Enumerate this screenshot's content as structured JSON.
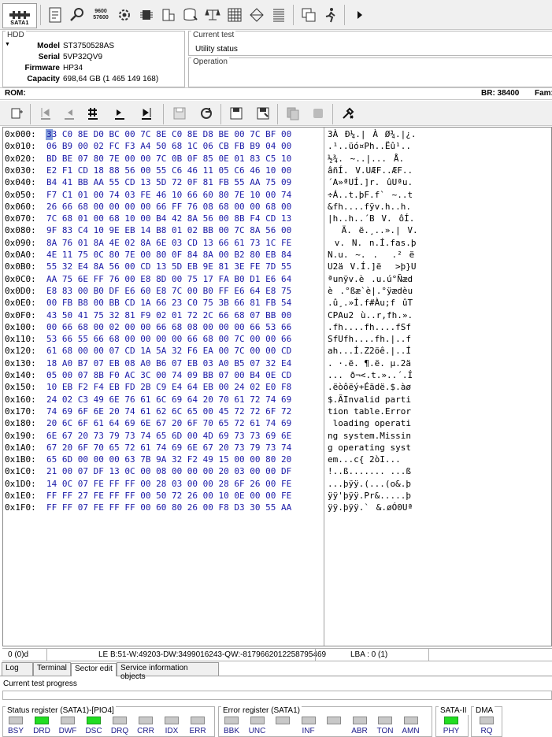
{
  "toolbar": {
    "sata_label": "SATA1",
    "icons": [
      "report-icon",
      "search-icon",
      "baud-rate-icon",
      "settings-icon",
      "chip-icon",
      "drive-icon",
      "database-icon",
      "balance-icon",
      "grid-icon",
      "tree-icon",
      "list-icon",
      "windows-icon",
      "run-icon",
      "play-icon"
    ],
    "baud_icon_text": [
      "9600",
      "57600"
    ]
  },
  "hdd": {
    "title": "HDD",
    "model_label": "Model",
    "model": "ST3750528AS",
    "serial_label": "Serial",
    "serial": "5VP32QV9",
    "firmware_label": "Firmware",
    "firmware": "HP34",
    "capacity_label": "Capacity",
    "capacity": "698,64 GB (1 465 149 168)"
  },
  "current_test": {
    "title": "Current test",
    "value": "Utility status"
  },
  "operation": {
    "title": "Operation",
    "value": ""
  },
  "rom_bar": {
    "rom_label": "ROM:",
    "br": "BR: 38400",
    "fam": "Fam:"
  },
  "hex": {
    "rows": [
      {
        "offset": "0x000:",
        "bytes": "33 C0 8E D0 BC 00 7C 8E C0 8E D8 BE 00 7C BF 00",
        "ascii": "3ÀÐ¼.|ÀØ¾.|¿."
      },
      {
        "offset": "0x010:",
        "bytes": "06 B9 00 02 FC F3 A4 50 68 1C 06 CB FB B9 04 00",
        "ascii": ".¹..üó¤Ph..Ëû¹.."
      },
      {
        "offset": "0x020:",
        "bytes": "BD BE 07 80 7E 00 00 7C 0B 0F 85 0E 01 83 C5 10",
        "ascii": "½¾.~..|...Å."
      },
      {
        "offset": "0x030:",
        "bytes": "E2 F1 CD 18 88 56 00 55 C6 46 11 05 C6 46 10 00",
        "ascii": "âñÍ.V.UÆF..ÆF.."
      },
      {
        "offset": "0x040:",
        "bytes": "B4 41 BB AA 55 CD 13 5D 72 0F 81 FB 55 AA 75 09",
        "ascii": "´A»ªUÍ.]r.ûUªu."
      },
      {
        "offset": "0x050:",
        "bytes": "F7 C1 01 00 74 03 FE 46 10 66 60 80 7E 10 00 74",
        "ascii": "÷Á..t.þF.f`~..t"
      },
      {
        "offset": "0x060:",
        "bytes": "26 66 68 00 00 00 00 66 FF 76 08 68 00 00 68 00",
        "ascii": "&fh....fÿv.h..h."
      },
      {
        "offset": "0x070:",
        "bytes": "7C 68 01 00 68 10 00 B4 42 8A 56 00 8B F4 CD 13",
        "ascii": "|h..h..´BV.ôÍ."
      },
      {
        "offset": "0x080:",
        "bytes": "9F 83 C4 10 9E EB 14 B8 01 02 BB 00 7C 8A 56 00",
        "ascii": "Ä.ë.¸..».|V."
      },
      {
        "offset": "0x090:",
        "bytes": "8A 76 01 8A 4E 02 8A 6E 03 CD 13 66 61 73 1C FE",
        "ascii": "v.N.n.Í.fas.þ"
      },
      {
        "offset": "0x0A0:",
        "bytes": "4E 11 75 0C 80 7E 00 80 0F 84 8A 00 B2 80 EB 84",
        "ascii": "N.u.~...²ë"
      },
      {
        "offset": "0x0B0:",
        "bytes": "55 32 E4 8A 56 00 CD 13 5D EB 9E 81 3E FE 7D 55",
        "ascii": "U2äV.Í.]ë>þ}U"
      },
      {
        "offset": "0x0C0:",
        "bytes": "AA 75 6E FF 76 00 E8 8D 00 75 17 FA B0 D1 E6 64",
        "ascii": "ªunÿv.è.u.ú°Ñæd"
      },
      {
        "offset": "0x0D0:",
        "bytes": "E8 83 00 B0 DF E6 60 E8 7C 00 B0 FF E6 64 E8 75",
        "ascii": "è.°ßæ`è|.°ÿædèu"
      },
      {
        "offset": "0x0E0:",
        "bytes": "00 FB B8 00 BB CD 1A 66 23 C0 75 3B 66 81 FB 54",
        "ascii": ".û¸.»Í.f#Àu;fûT"
      },
      {
        "offset": "0x0F0:",
        "bytes": "43 50 41 75 32 81 F9 02 01 72 2C 66 68 07 BB 00",
        "ascii": "CPAu2ù..r,fh.»."
      },
      {
        "offset": "0x100:",
        "bytes": "00 66 68 00 02 00 00 66 68 08 00 00 00 66 53 66",
        "ascii": ".fh....fh....fSf"
      },
      {
        "offset": "0x110:",
        "bytes": "53 66 55 66 68 00 00 00 00 66 68 00 7C 00 00 66",
        "ascii": "SfUfh....fh.|..f"
      },
      {
        "offset": "0x120:",
        "bytes": "61 68 00 00 07 CD 1A 5A 32 F6 EA 00 7C 00 00 CD",
        "ascii": "ah...Í.Z2öê.|..Í"
      },
      {
        "offset": "0x130:",
        "bytes": "18 A0 B7 07 EB 08 A0 B6 07 EB 03 A0 B5 07 32 E4",
        "ascii": ". ·.ë. ¶.ë. µ.2ä"
      },
      {
        "offset": "0x140:",
        "bytes": "05 00 07 8B F0 AC 3C 00 74 09 BB 07 00 B4 0E CD",
        "ascii": "...ð¬<.t.»..´.Í"
      },
      {
        "offset": "0x150:",
        "bytes": "10 EB F2 F4 EB FD 2B C9 E4 64 EB 00 24 02 E0 F8",
        "ascii": ".ëòôëý+Éädë.$.àø"
      },
      {
        "offset": "0x160:",
        "bytes": "24 02 C3 49 6E 76 61 6C 69 64 20 70 61 72 74 69",
        "ascii": "$.ÃInvalid parti"
      },
      {
        "offset": "0x170:",
        "bytes": "74 69 6F 6E 20 74 61 62 6C 65 00 45 72 72 6F 72",
        "ascii": "tion table.Error"
      },
      {
        "offset": "0x180:",
        "bytes": "20 6C 6F 61 64 69 6E 67 20 6F 70 65 72 61 74 69",
        "ascii": " loading operati"
      },
      {
        "offset": "0x190:",
        "bytes": "6E 67 20 73 79 73 74 65 6D 00 4D 69 73 73 69 6E",
        "ascii": "ng system.Missin"
      },
      {
        "offset": "0x1A0:",
        "bytes": "67 20 6F 70 65 72 61 74 69 6E 67 20 73 79 73 74",
        "ascii": "g operating syst"
      },
      {
        "offset": "0x1B0:",
        "bytes": "65 6D 00 00 00 63 7B 9A 32 F2 49 15 00 00 80 20",
        "ascii": "em...c{2òI... "
      },
      {
        "offset": "0x1C0:",
        "bytes": "21 00 07 DF 13 0C 00 08 00 00 00 20 03 00 00 DF",
        "ascii": "!..ß....... ...ß"
      },
      {
        "offset": "0x1D0:",
        "bytes": "14 0C 07 FE FF FF 00 28 03 00 00 28 6F 26 00 FE",
        "ascii": "...þÿÿ.(...(o&.þ"
      },
      {
        "offset": "0x1E0:",
        "bytes": "FF FF 27 FE FF FF 00 50 72 26 00 10 0E 00 00 FE",
        "ascii": "ÿÿ'þÿÿ.Pr&.....þ"
      },
      {
        "offset": "0x1F0:",
        "bytes": "FF FF 07 FE FF FF 00 60 80 26 00 F8 D3 30 55 AA",
        "ascii": "ÿÿ.þÿÿ.`&.øÓ0Uª"
      }
    ]
  },
  "status_line": {
    "position": "0 (0)d",
    "le_values": "LE B:51-W:49203-DW:3499016243-QW:-8179662012258795469",
    "lba": "LBA : 0 (1)"
  },
  "tabs": [
    {
      "label": "Log",
      "active": false
    },
    {
      "label": "Terminal",
      "active": false
    },
    {
      "label": "Sector edit",
      "active": true
    },
    {
      "label": "Service information objects",
      "active": false
    }
  ],
  "progress": {
    "label": "Current test progress"
  },
  "status_register": {
    "title": "Status register (SATA1)-[PIO4]",
    "leds": [
      {
        "name": "BSY",
        "on": false
      },
      {
        "name": "DRD",
        "on": true
      },
      {
        "name": "DWF",
        "on": false
      },
      {
        "name": "DSC",
        "on": true
      },
      {
        "name": "DRQ",
        "on": false
      },
      {
        "name": "CRR",
        "on": false
      },
      {
        "name": "IDX",
        "on": false
      },
      {
        "name": "ERR",
        "on": false
      }
    ]
  },
  "error_register": {
    "title": "Error register (SATA1)",
    "leds": [
      {
        "name": "BBK",
        "on": false
      },
      {
        "name": "UNC",
        "on": false
      },
      {
        "name": "",
        "on": false
      },
      {
        "name": "INF",
        "on": false
      },
      {
        "name": "",
        "on": false
      },
      {
        "name": "ABR",
        "on": false
      },
      {
        "name": "TON",
        "on": false
      },
      {
        "name": "AMN",
        "on": false
      }
    ]
  },
  "sata2": {
    "title": "SATA-II",
    "led": {
      "name": "PHY",
      "on": true
    }
  },
  "dma": {
    "title": "DMA",
    "led": {
      "name": "RQ",
      "on": false
    }
  },
  "colors": {
    "led_on": "#22dd22",
    "led_off": "#c8c8c8",
    "hex_bytes": "#1a1aa8"
  }
}
